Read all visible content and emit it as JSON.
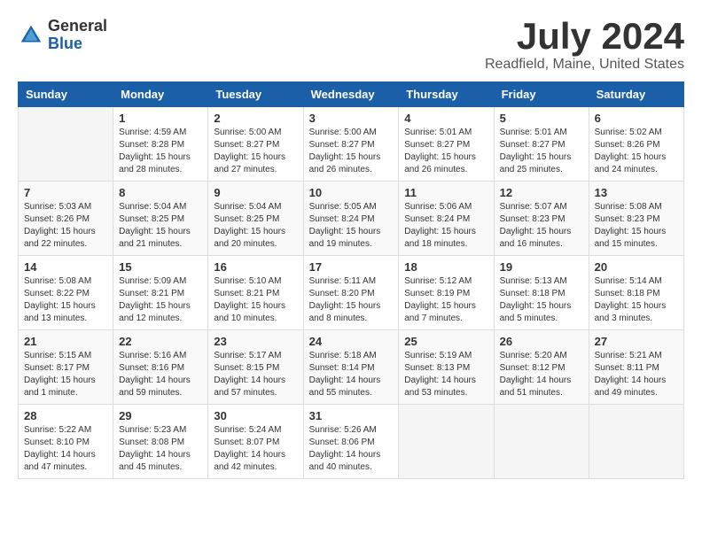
{
  "header": {
    "logo": {
      "general": "General",
      "blue": "Blue"
    },
    "title": "July 2024",
    "location": "Readfield, Maine, United States"
  },
  "calendar": {
    "headers": [
      "Sunday",
      "Monday",
      "Tuesday",
      "Wednesday",
      "Thursday",
      "Friday",
      "Saturday"
    ],
    "weeks": [
      [
        {
          "day": "",
          "info": ""
        },
        {
          "day": "1",
          "info": "Sunrise: 4:59 AM\nSunset: 8:28 PM\nDaylight: 15 hours\nand 28 minutes."
        },
        {
          "day": "2",
          "info": "Sunrise: 5:00 AM\nSunset: 8:27 PM\nDaylight: 15 hours\nand 27 minutes."
        },
        {
          "day": "3",
          "info": "Sunrise: 5:00 AM\nSunset: 8:27 PM\nDaylight: 15 hours\nand 26 minutes."
        },
        {
          "day": "4",
          "info": "Sunrise: 5:01 AM\nSunset: 8:27 PM\nDaylight: 15 hours\nand 26 minutes."
        },
        {
          "day": "5",
          "info": "Sunrise: 5:01 AM\nSunset: 8:27 PM\nDaylight: 15 hours\nand 25 minutes."
        },
        {
          "day": "6",
          "info": "Sunrise: 5:02 AM\nSunset: 8:26 PM\nDaylight: 15 hours\nand 24 minutes."
        }
      ],
      [
        {
          "day": "7",
          "info": "Sunrise: 5:03 AM\nSunset: 8:26 PM\nDaylight: 15 hours\nand 22 minutes."
        },
        {
          "day": "8",
          "info": "Sunrise: 5:04 AM\nSunset: 8:25 PM\nDaylight: 15 hours\nand 21 minutes."
        },
        {
          "day": "9",
          "info": "Sunrise: 5:04 AM\nSunset: 8:25 PM\nDaylight: 15 hours\nand 20 minutes."
        },
        {
          "day": "10",
          "info": "Sunrise: 5:05 AM\nSunset: 8:24 PM\nDaylight: 15 hours\nand 19 minutes."
        },
        {
          "day": "11",
          "info": "Sunrise: 5:06 AM\nSunset: 8:24 PM\nDaylight: 15 hours\nand 18 minutes."
        },
        {
          "day": "12",
          "info": "Sunrise: 5:07 AM\nSunset: 8:23 PM\nDaylight: 15 hours\nand 16 minutes."
        },
        {
          "day": "13",
          "info": "Sunrise: 5:08 AM\nSunset: 8:23 PM\nDaylight: 15 hours\nand 15 minutes."
        }
      ],
      [
        {
          "day": "14",
          "info": "Sunrise: 5:08 AM\nSunset: 8:22 PM\nDaylight: 15 hours\nand 13 minutes."
        },
        {
          "day": "15",
          "info": "Sunrise: 5:09 AM\nSunset: 8:21 PM\nDaylight: 15 hours\nand 12 minutes."
        },
        {
          "day": "16",
          "info": "Sunrise: 5:10 AM\nSunset: 8:21 PM\nDaylight: 15 hours\nand 10 minutes."
        },
        {
          "day": "17",
          "info": "Sunrise: 5:11 AM\nSunset: 8:20 PM\nDaylight: 15 hours\nand 8 minutes."
        },
        {
          "day": "18",
          "info": "Sunrise: 5:12 AM\nSunset: 8:19 PM\nDaylight: 15 hours\nand 7 minutes."
        },
        {
          "day": "19",
          "info": "Sunrise: 5:13 AM\nSunset: 8:18 PM\nDaylight: 15 hours\nand 5 minutes."
        },
        {
          "day": "20",
          "info": "Sunrise: 5:14 AM\nSunset: 8:18 PM\nDaylight: 15 hours\nand 3 minutes."
        }
      ],
      [
        {
          "day": "21",
          "info": "Sunrise: 5:15 AM\nSunset: 8:17 PM\nDaylight: 15 hours\nand 1 minute."
        },
        {
          "day": "22",
          "info": "Sunrise: 5:16 AM\nSunset: 8:16 PM\nDaylight: 14 hours\nand 59 minutes."
        },
        {
          "day": "23",
          "info": "Sunrise: 5:17 AM\nSunset: 8:15 PM\nDaylight: 14 hours\nand 57 minutes."
        },
        {
          "day": "24",
          "info": "Sunrise: 5:18 AM\nSunset: 8:14 PM\nDaylight: 14 hours\nand 55 minutes."
        },
        {
          "day": "25",
          "info": "Sunrise: 5:19 AM\nSunset: 8:13 PM\nDaylight: 14 hours\nand 53 minutes."
        },
        {
          "day": "26",
          "info": "Sunrise: 5:20 AM\nSunset: 8:12 PM\nDaylight: 14 hours\nand 51 minutes."
        },
        {
          "day": "27",
          "info": "Sunrise: 5:21 AM\nSunset: 8:11 PM\nDaylight: 14 hours\nand 49 minutes."
        }
      ],
      [
        {
          "day": "28",
          "info": "Sunrise: 5:22 AM\nSunset: 8:10 PM\nDaylight: 14 hours\nand 47 minutes."
        },
        {
          "day": "29",
          "info": "Sunrise: 5:23 AM\nSunset: 8:08 PM\nDaylight: 14 hours\nand 45 minutes."
        },
        {
          "day": "30",
          "info": "Sunrise: 5:24 AM\nSunset: 8:07 PM\nDaylight: 14 hours\nand 42 minutes."
        },
        {
          "day": "31",
          "info": "Sunrise: 5:26 AM\nSunset: 8:06 PM\nDaylight: 14 hours\nand 40 minutes."
        },
        {
          "day": "",
          "info": ""
        },
        {
          "day": "",
          "info": ""
        },
        {
          "day": "",
          "info": ""
        }
      ]
    ]
  }
}
